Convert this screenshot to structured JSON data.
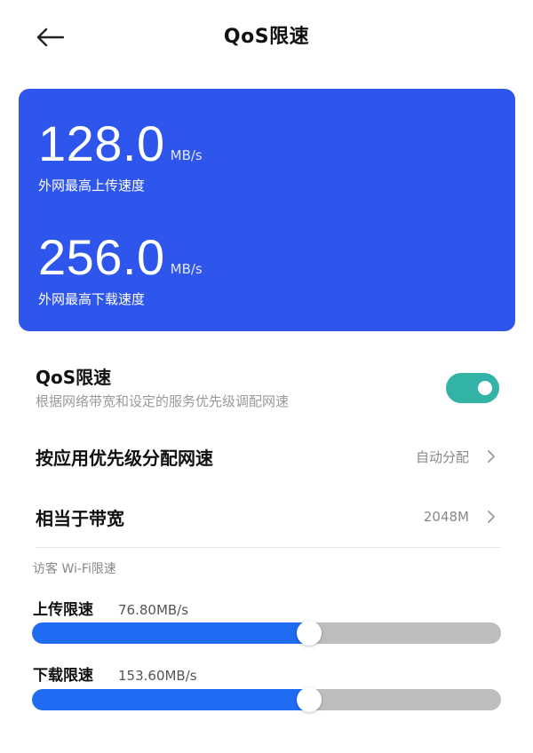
{
  "header": {
    "title": "QoS限速"
  },
  "card": {
    "upload": {
      "value": "128.0",
      "unit": "MB/s",
      "label": "外网最高上传速度"
    },
    "download": {
      "value": "256.0",
      "unit": "MB/s",
      "label": "外网最高下载速度"
    }
  },
  "qos": {
    "title": "QoS限速",
    "description": "根据网络带宽和设定的服务优先级调配网速",
    "enabled": true
  },
  "settings": {
    "priority": {
      "label": "按应用优先级分配网速",
      "value": "自动分配"
    },
    "bandwidth": {
      "label": "相当于带宽",
      "value": "2048M"
    }
  },
  "guest": {
    "section_title": "访客 Wi-Fi限速",
    "upload": {
      "label": "上传限速",
      "value": "76.80MB/s",
      "level": 0.59
    },
    "download": {
      "label": "下载限速",
      "value": "153.60MB/s",
      "level": 0.59
    }
  },
  "colors": {
    "card": "#2f56ec",
    "toggle": "#33b3a6",
    "slider_fill": "#1f6bf2",
    "slider_track": "#bdbdbd"
  }
}
